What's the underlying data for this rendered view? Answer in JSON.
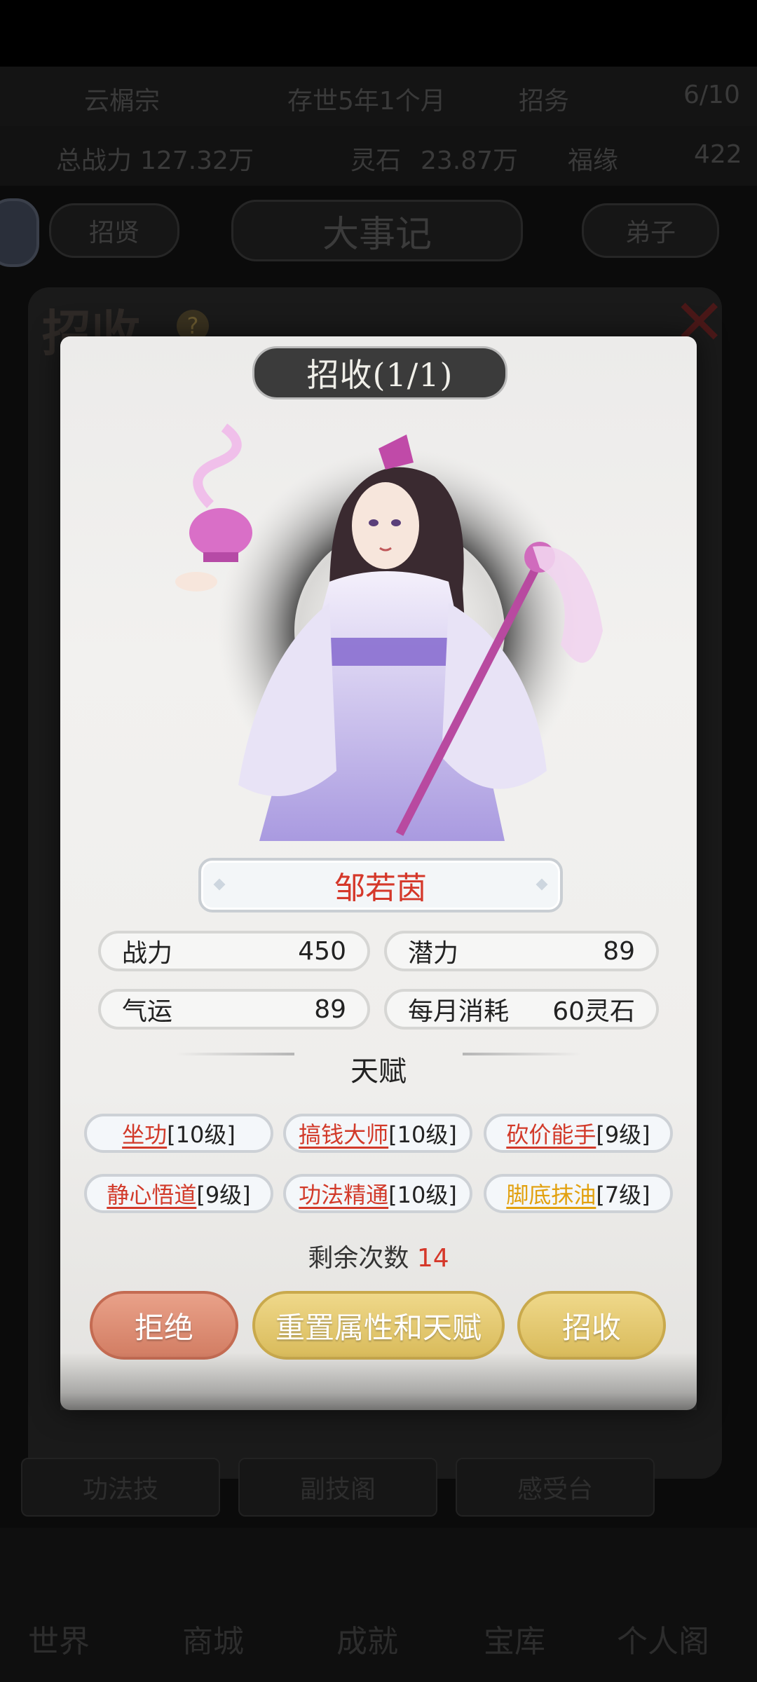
{
  "background": {
    "sect_name": "云榍宗",
    "survival_time": "存世5年1个月",
    "top_right_1": "招务",
    "top_right_2": "6/10",
    "power_label": "总战力",
    "power_value": "127.32万",
    "spirit_label": "灵石",
    "spirit_value": "23.87万",
    "misc_label": "福缘",
    "misc_value": "422",
    "left_button": "招贤",
    "center_title": "大事记",
    "right_button": "弟子",
    "panel_title": "招收",
    "help_icon_text": "?",
    "row_buttons": [
      "功法技",
      "副技阁",
      "感受台"
    ],
    "nav": [
      "世界",
      "商城",
      "成就",
      "宝库",
      "个人阁"
    ]
  },
  "modal": {
    "tab_title": "招收(1/1)",
    "character_name": "邹若茵",
    "stats": {
      "power_label": "战力",
      "power_value": "450",
      "potential_label": "潜力",
      "potential_value": "89",
      "luck_label": "气运",
      "luck_value": "89",
      "monthly_cost_label": "每月消耗",
      "monthly_cost_value": "60灵石"
    },
    "talent_title": "天赋",
    "talents": [
      {
        "name": "坐功",
        "level": "[10级]",
        "color": "#d23a2a"
      },
      {
        "name": "搞钱大师",
        "level": "[10级]",
        "color": "#d23a2a"
      },
      {
        "name": "砍价能手",
        "level": "[9级]",
        "color": "#d23a2a"
      },
      {
        "name": "静心悟道",
        "level": "[9级]",
        "color": "#d23a2a"
      },
      {
        "name": "功法精通",
        "level": "[10级]",
        "color": "#d23a2a"
      },
      {
        "name": "脚底抹油",
        "level": "[7级]",
        "color": "#e2a10f"
      }
    ],
    "remaining_label": "剩余次数",
    "remaining_value": "14",
    "buttons": {
      "reject": "拒绝",
      "reset": "重置属性和天赋",
      "recruit": "招收"
    }
  }
}
